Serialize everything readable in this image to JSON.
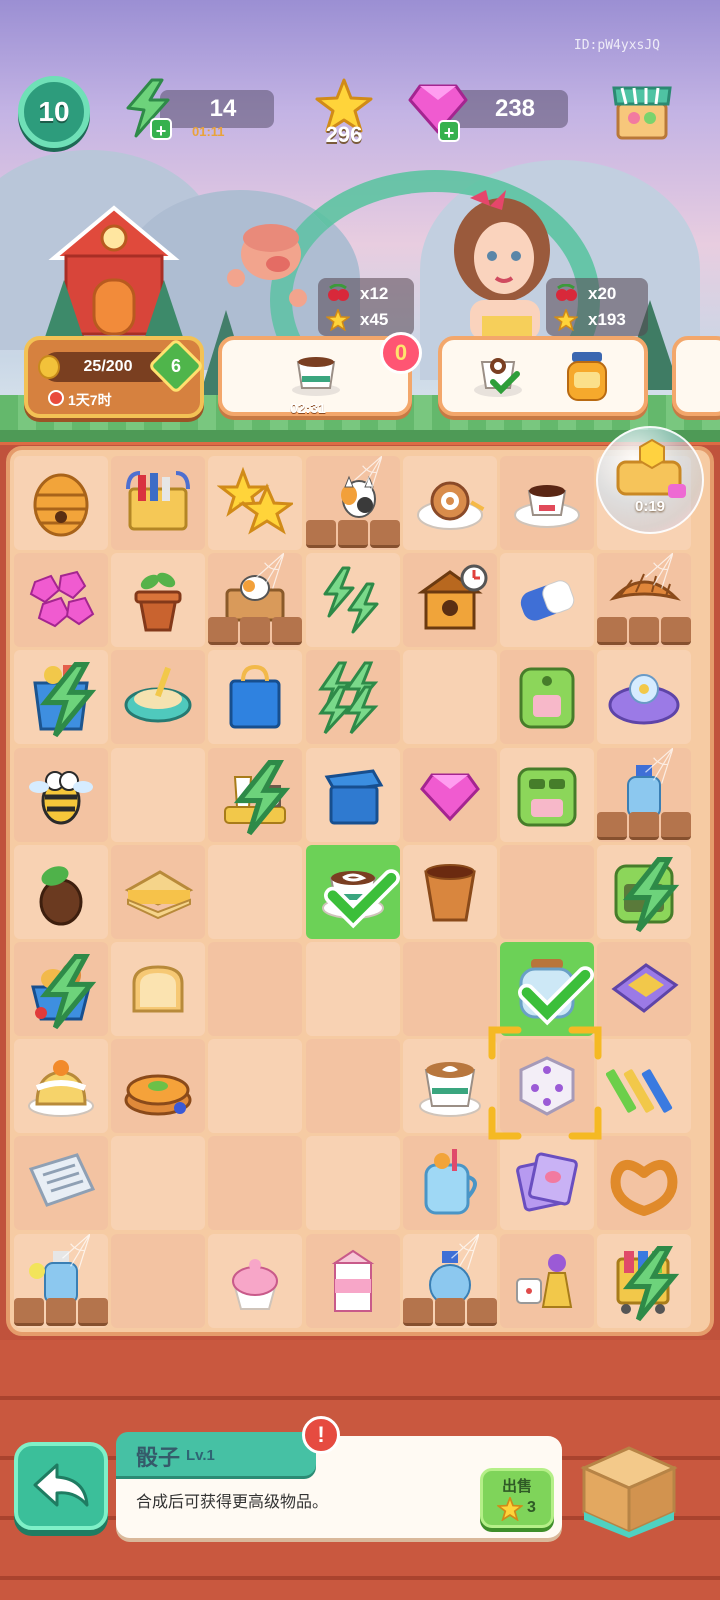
{
  "header": {
    "player_id": "ID:pW4yxsJQ",
    "level": "10",
    "energy": "14",
    "energy_timer": "01:11",
    "stars": "296",
    "gems": "238"
  },
  "house": {
    "progress": "25/200",
    "level": "6",
    "timer": "1天7时"
  },
  "orders": {
    "reward1": {
      "berries": "x12",
      "stars": "x45"
    },
    "reward2": {
      "berries": "x20",
      "stars": "x193"
    },
    "order1_badge": "0",
    "order1_timer": "02:31"
  },
  "board": {
    "bubble_timer": "0:19",
    "items": [
      [
        "beehive",
        "file-rack",
        "two-stars",
        "cat-locked",
        "swiss-roll-plate",
        "coffee-cup-saucer",
        "bubble-honey"
      ],
      [
        "pink-gems",
        "plant-pot",
        "cat-box-locked",
        "energy-bolts",
        "bee-house-timer",
        "eraser",
        "croissants-locked"
      ],
      [
        "grocery-bag-bolt",
        "litter-box",
        "blue-bag",
        "energy-bolts-big",
        "empty",
        "green-toaster",
        "toy-mat"
      ],
      [
        "bee",
        "empty",
        "tea-set-bolt",
        "blue-box",
        "pink-gem",
        "green-toaster-2",
        "bottle-locked"
      ],
      [
        "acorn",
        "sandwich",
        "empty",
        "latte-check",
        "tea-cup",
        "empty",
        "green-oven-bolt"
      ],
      [
        "bread-basket-bolt",
        "toast",
        "empty",
        "empty",
        "empty",
        "glass-jar-check",
        "purple-tray"
      ],
      [
        "orange-cake",
        "orange-pie",
        "empty",
        "empty",
        "latte-art",
        "dice-selected",
        "crayons"
      ],
      [
        "newspaper",
        "empty",
        "empty",
        "empty",
        "juice-jar",
        "photo-cards",
        "pretzel"
      ],
      [
        "bottle-locked-2",
        "empty",
        "cupcake",
        "milk-carton",
        "bottle-locked-3",
        "game-pieces",
        "cart-bolt"
      ]
    ]
  },
  "info": {
    "item_name": "骰子",
    "item_level": "Lv.1",
    "description": "合成后可获得更高级物品。",
    "alert": "!",
    "sell_label": "出售",
    "sell_price": "3"
  }
}
